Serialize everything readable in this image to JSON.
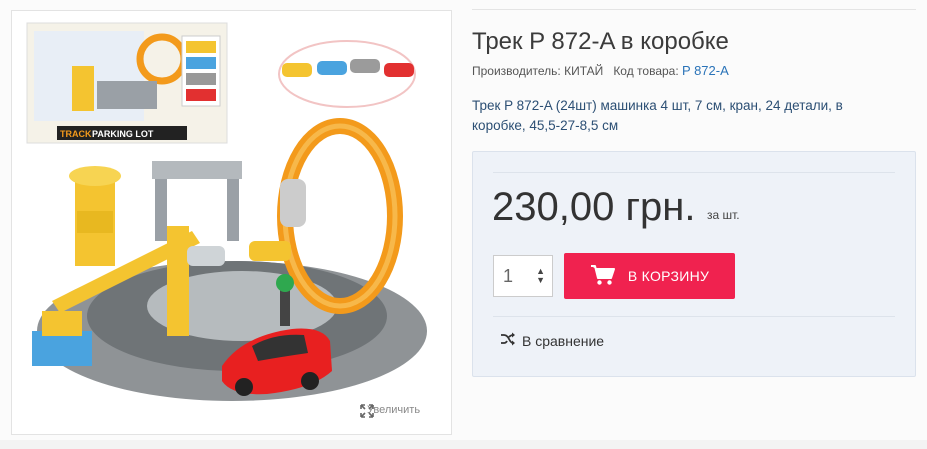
{
  "product": {
    "title": "Трек P 872-A в коробке",
    "manufacturer_label": "Производитель:",
    "manufacturer_value": "КИТАЙ",
    "code_label": "Код товара:",
    "code_value": "P 872-A",
    "description": "Трек P 872-A (24шт) машинка 4 шт, 7 см, кран, 24 детали, в коробке, 45,5-27-8,5 см"
  },
  "gallery": {
    "zoom_label": "Увеличить",
    "box_text": "PARKING LOT",
    "box_track": "TRACK"
  },
  "purchase": {
    "price": "230,00 грн.",
    "per_unit": "за шт.",
    "quantity": "1",
    "cart_button": "В КОРЗИНУ",
    "compare_label": "В сравнение"
  },
  "colors": {
    "cart_button": "#f0224f",
    "price_box_bg": "#eef2f8",
    "code_link": "#2a73b8"
  },
  "icons": [
    "expand-icon",
    "cart-icon",
    "shuffle-icon",
    "spinner-arrows-icon"
  ]
}
